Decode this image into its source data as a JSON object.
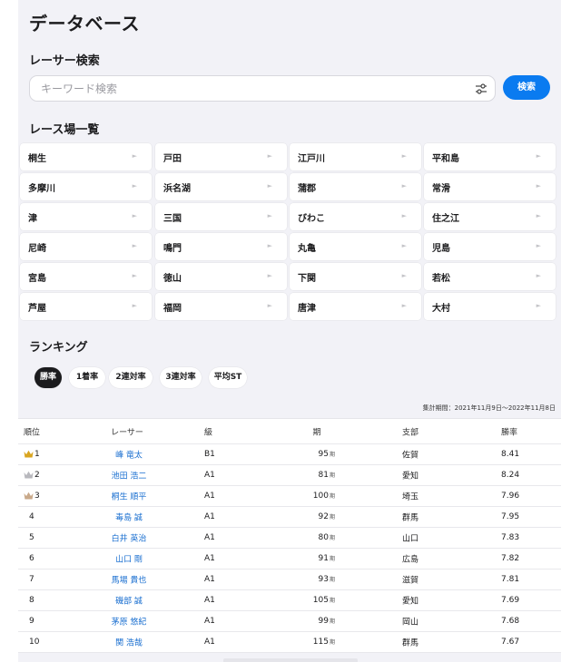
{
  "header": {
    "title": "データベース"
  },
  "racer_search": {
    "title": "レーサー検索",
    "placeholder": "キーワード検索",
    "button_label": "検索"
  },
  "venues": {
    "title": "レース場一覧",
    "arrow": "►",
    "items": [
      "桐生",
      "戸田",
      "江戸川",
      "平和島",
      "多摩川",
      "浜名湖",
      "蒲郡",
      "常滑",
      "津",
      "三国",
      "びわこ",
      "住之江",
      "尼崎",
      "鳴門",
      "丸亀",
      "児島",
      "宮島",
      "徳山",
      "下関",
      "若松",
      "芦屋",
      "福岡",
      "唐津",
      "大村"
    ]
  },
  "ranking": {
    "title": "ランキング",
    "tabs": [
      "勝率",
      "1着率",
      "2連対率",
      "3連対率",
      "平均ST"
    ],
    "active_tab": 0,
    "period": "集計期間：2021年11月9日〜2022年11月8日",
    "columns": [
      "順位",
      "レーサー",
      "級",
      "期",
      "支部",
      "勝率"
    ],
    "period_suffix": "期",
    "rows": [
      {
        "rank": "1",
        "name": "峰 竜太",
        "class": "B1",
        "period": "95",
        "branch": "佐賀",
        "rate": "8.41",
        "crown": "gold"
      },
      {
        "rank": "2",
        "name": "池田 浩二",
        "class": "A1",
        "period": "81",
        "branch": "愛知",
        "rate": "8.24",
        "crown": "silver"
      },
      {
        "rank": "3",
        "name": "桐生 順平",
        "class": "A1",
        "period": "100",
        "branch": "埼玉",
        "rate": "7.96",
        "crown": "bronze"
      },
      {
        "rank": "4",
        "name": "毒島 誠",
        "class": "A1",
        "period": "92",
        "branch": "群馬",
        "rate": "7.95",
        "crown": ""
      },
      {
        "rank": "5",
        "name": "白井 英治",
        "class": "A1",
        "period": "80",
        "branch": "山口",
        "rate": "7.83",
        "crown": ""
      },
      {
        "rank": "6",
        "name": "山口 剛",
        "class": "A1",
        "period": "91",
        "branch": "広島",
        "rate": "7.82",
        "crown": ""
      },
      {
        "rank": "7",
        "name": "馬場 貴也",
        "class": "A1",
        "period": "93",
        "branch": "滋賀",
        "rate": "7.81",
        "crown": ""
      },
      {
        "rank": "8",
        "name": "磯部 誠",
        "class": "A1",
        "period": "105",
        "branch": "愛知",
        "rate": "7.69",
        "crown": ""
      },
      {
        "rank": "9",
        "name": "茅原 悠紀",
        "class": "A1",
        "period": "99",
        "branch": "岡山",
        "rate": "7.68",
        "crown": ""
      },
      {
        "rank": "10",
        "name": "関 浩哉",
        "class": "A1",
        "period": "115",
        "branch": "群馬",
        "rate": "7.67",
        "crown": ""
      }
    ]
  },
  "colors": {
    "accent": "#0a7bf0",
    "link": "#1a6fd0",
    "gold": "#d9a520",
    "silver": "#b8b8bd",
    "bronze": "#c9a98a"
  }
}
